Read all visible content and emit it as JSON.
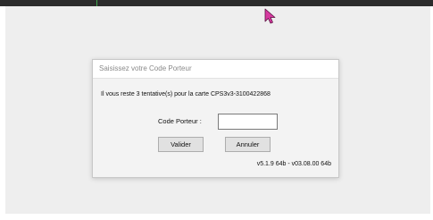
{
  "dialog": {
    "title": "Saisissez votre Code Porteur",
    "message": "Il vous reste 3 tentative(s) pour la carte CPS3v3-3100422868",
    "field_label": "Code Porteur :",
    "field_value": "",
    "ok_label": "Valider",
    "cancel_label": "Annuler",
    "version": "v5.1.9 64b - v03.08.00 64b"
  },
  "colors": {
    "topbar": "#2b2b2b",
    "cursor": "#d63aa0"
  }
}
